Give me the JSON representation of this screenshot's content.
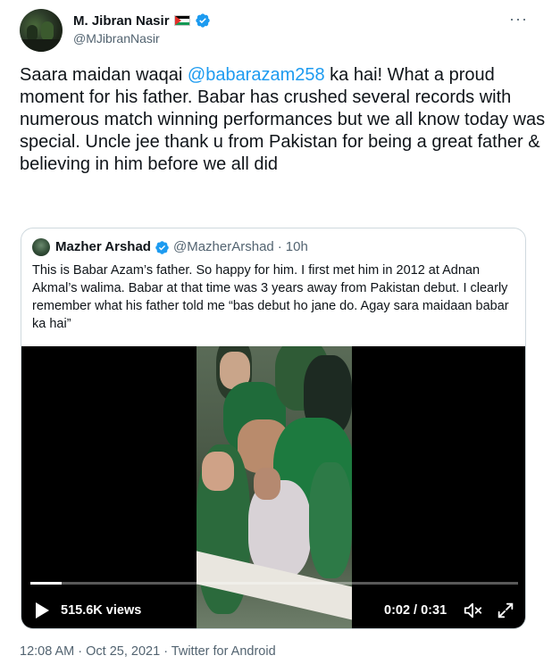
{
  "author": {
    "display_name": "M. Jibran Nasir",
    "handle": "@MJibranNasir",
    "flag_icon": "palestine-flag-icon",
    "verified_icon": "verified-badge-icon",
    "more_label": "···"
  },
  "tweet": {
    "text_before": "Saara maidan waqai ",
    "mention": "@babarazam258",
    "text_after": " ka hai! What a proud moment for his father. Babar has crushed several records with numerous match winning performances but we all know today was special. Uncle jee thank u from Pakistan for being a great father & believing in him before we all did"
  },
  "quoted": {
    "display_name": "Mazher Arshad",
    "handle": "@MazherArshad",
    "separator": "·",
    "time_ago": "10h",
    "text": "This is Babar Azam’s father. So happy for him. I first met him in 2012 at Adnan Akmal’s walima. Babar at that time was 3 years away from Pakistan debut. I clearly remember what his father told me “bas debut ho jane do. Agay sara maidaan babar ka hai”"
  },
  "video": {
    "views": "515.6K views",
    "time_display": "0:02 / 0:31",
    "progress_fraction": 0.065,
    "icons": [
      "play-icon",
      "muted-speaker-icon",
      "fullscreen-expand-icon"
    ]
  },
  "footer": {
    "timestamp": "12:08 AM · Oct 25, 2021 · Twitter for Android"
  },
  "colors": {
    "accent": "#1d9bf0",
    "text": "#0f1419",
    "secondary": "#536471",
    "border": "#cfd9de"
  }
}
